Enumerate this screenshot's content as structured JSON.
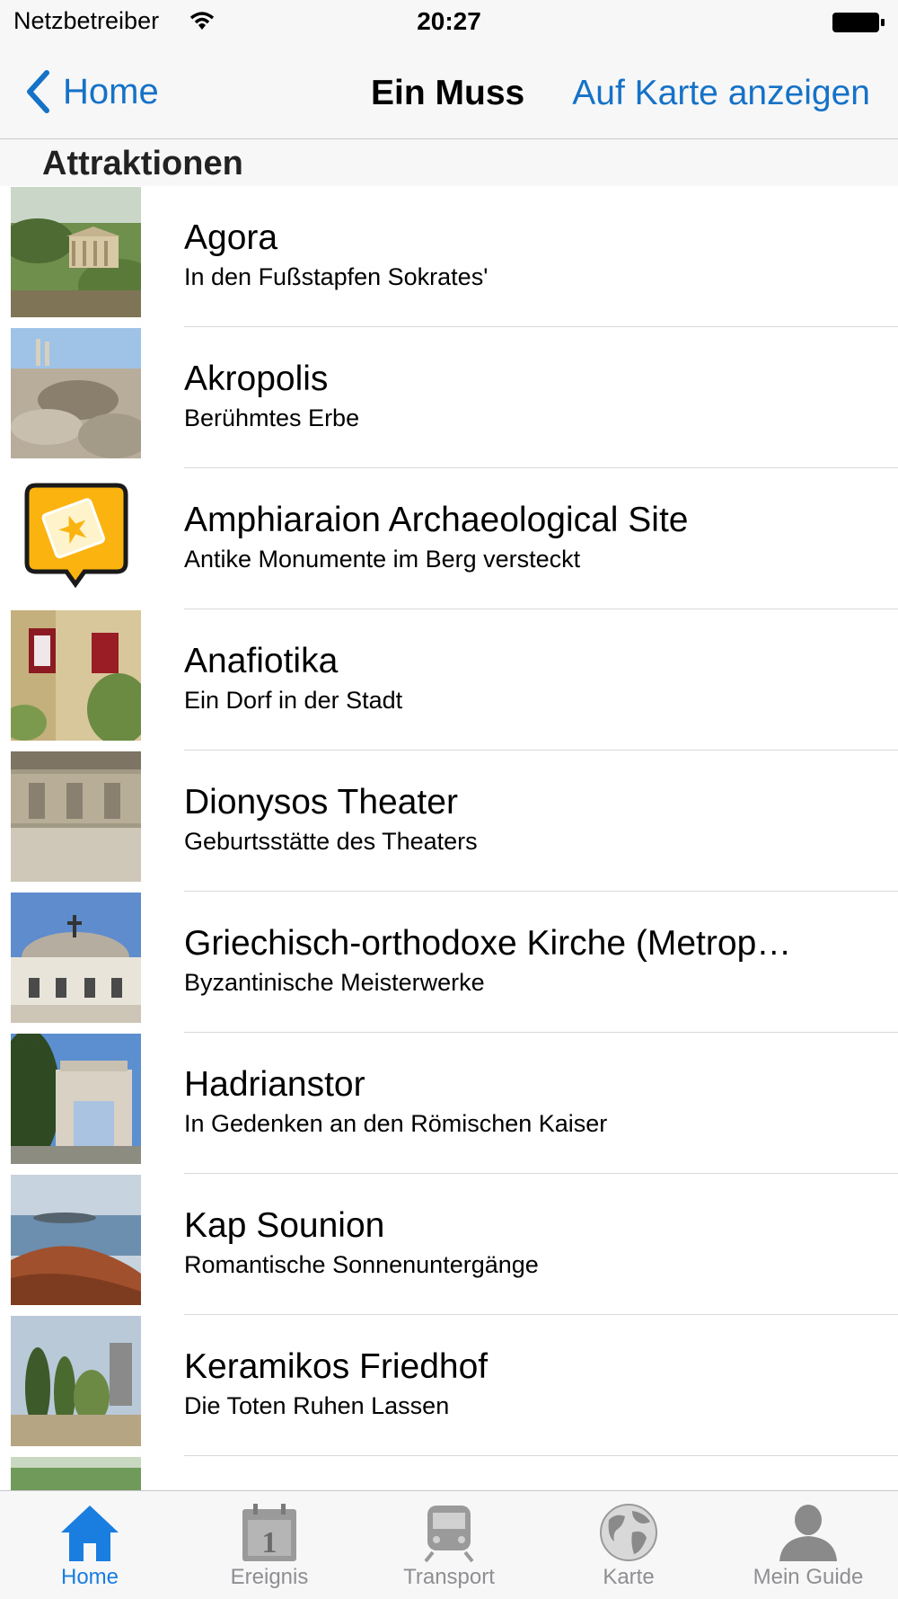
{
  "status": {
    "carrier": "Netzbetreiber",
    "time": "20:27"
  },
  "nav": {
    "back_label": "Home",
    "title": "Ein Muss",
    "right_label": "Auf Karte anzeigen"
  },
  "section": {
    "title": "Attraktionen"
  },
  "items": [
    {
      "title": "Agora",
      "subtitle": "In den Fußstapfen Sokrates'"
    },
    {
      "title": "Akropolis",
      "subtitle": "Berühmtes Erbe"
    },
    {
      "title": "Amphiaraion Archaeological Site",
      "subtitle": "Antike Monumente im Berg versteckt"
    },
    {
      "title": "Anafiotika",
      "subtitle": "Ein Dorf in der Stadt"
    },
    {
      "title": "Dionysos Theater",
      "subtitle": "Geburtsstätte des Theaters"
    },
    {
      "title": "Griechisch-orthodoxe Kirche (Metrop…",
      "subtitle": "Byzantinische Meisterwerke"
    },
    {
      "title": "Hadrianstor",
      "subtitle": "In Gedenken an den Römischen Kaiser"
    },
    {
      "title": "Kap Sounion",
      "subtitle": "Romantische Sonnenuntergänge"
    },
    {
      "title": "Keramikos Friedhof",
      "subtitle": "Die Toten Ruhen Lassen"
    }
  ],
  "tabs": [
    {
      "label": "Home",
      "icon": "home-icon",
      "active": true
    },
    {
      "label": "Ereignis",
      "icon": "calendar-icon",
      "active": false
    },
    {
      "label": "Transport",
      "icon": "train-icon",
      "active": false
    },
    {
      "label": "Karte",
      "icon": "globe-icon",
      "active": false
    },
    {
      "label": "Mein Guide",
      "icon": "person-icon",
      "active": false
    }
  ],
  "colors": {
    "accent": "#1572c7",
    "tab_active": "#1a7de0",
    "tab_inactive": "#8e8e93",
    "bar_bg": "#f7f7f7"
  }
}
